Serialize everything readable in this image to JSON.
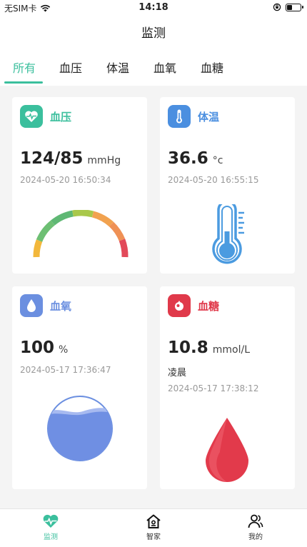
{
  "status_bar": {
    "carrier": "无SIM卡",
    "time": "14:18",
    "battery_level": 0.35
  },
  "header": {
    "title": "监测"
  },
  "tabs": [
    {
      "label": "所有",
      "active": true
    },
    {
      "label": "血压",
      "active": false
    },
    {
      "label": "体温",
      "active": false
    },
    {
      "label": "血氧",
      "active": false
    },
    {
      "label": "血糖",
      "active": false
    }
  ],
  "cards": {
    "blood_pressure": {
      "title": "血压",
      "value": "124/85",
      "unit": "mmHg",
      "time": "2024-05-20 16:50:34",
      "accent": "#3bbf9d"
    },
    "temperature": {
      "title": "体温",
      "value": "36.6",
      "unit": "°c",
      "time": "2024-05-20 16:55:15",
      "accent": "#4b8fe0"
    },
    "oxygen": {
      "title": "血氧",
      "value": "100",
      "unit": "%",
      "time": "2024-05-17 17:36:47",
      "accent": "#6b8fe0"
    },
    "glucose": {
      "title": "血糖",
      "value": "10.8",
      "unit": "mmol/L",
      "note": "凌晨",
      "time": "2024-05-17 17:38:12",
      "accent": "#e0394a"
    }
  },
  "tab_bar": [
    {
      "label": "监测",
      "icon": "heart-pulse-icon",
      "active": true
    },
    {
      "label": "智家",
      "icon": "home-icon",
      "active": false
    },
    {
      "label": "我的",
      "icon": "users-icon",
      "active": false
    }
  ],
  "colors": {
    "primary": "#3bbf9d",
    "background": "#f4f4f4"
  }
}
